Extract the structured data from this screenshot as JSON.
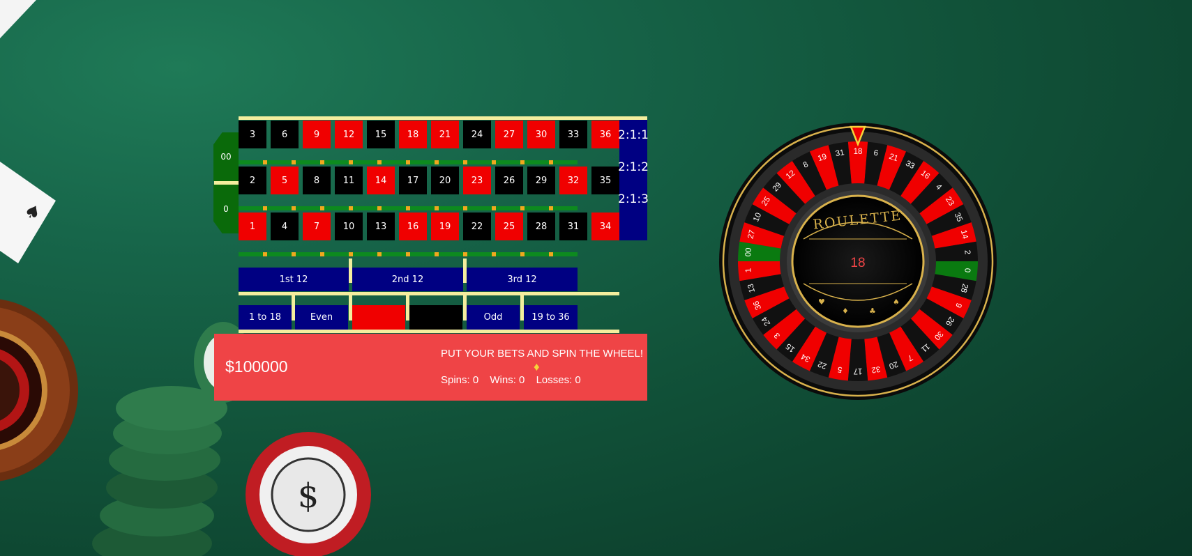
{
  "table": {
    "rows": [
      [
        [
          "3",
          "black"
        ],
        [
          "6",
          "black"
        ],
        [
          "9",
          "red"
        ],
        [
          "12",
          "red"
        ],
        [
          "15",
          "black"
        ],
        [
          "18",
          "red"
        ],
        [
          "21",
          "red"
        ],
        [
          "24",
          "black"
        ],
        [
          "27",
          "red"
        ],
        [
          "30",
          "red"
        ],
        [
          "33",
          "black"
        ],
        [
          "36",
          "red"
        ]
      ],
      [
        [
          "2",
          "black"
        ],
        [
          "5",
          "red"
        ],
        [
          "8",
          "black"
        ],
        [
          "11",
          "black"
        ],
        [
          "14",
          "red"
        ],
        [
          "17",
          "black"
        ],
        [
          "20",
          "black"
        ],
        [
          "23",
          "red"
        ],
        [
          "26",
          "black"
        ],
        [
          "29",
          "black"
        ],
        [
          "32",
          "red"
        ],
        [
          "35",
          "black"
        ]
      ],
      [
        [
          "1",
          "red"
        ],
        [
          "4",
          "black"
        ],
        [
          "7",
          "red"
        ],
        [
          "10",
          "black"
        ],
        [
          "13",
          "black"
        ],
        [
          "16",
          "red"
        ],
        [
          "19",
          "red"
        ],
        [
          "22",
          "black"
        ],
        [
          "25",
          "red"
        ],
        [
          "28",
          "black"
        ],
        [
          "31",
          "black"
        ],
        [
          "34",
          "red"
        ]
      ]
    ],
    "zero_top": "00",
    "zero_bottom": "0",
    "column_bets": [
      "2:1:1",
      "2:1:2",
      "2:1:3"
    ],
    "dozens": [
      "1st 12",
      "2nd 12",
      "3rd 12"
    ],
    "even_money": [
      {
        "label": "1 to 18",
        "fill": "#000082"
      },
      {
        "label": "Even",
        "fill": "#000082"
      },
      {
        "label": "",
        "fill": "#f00000"
      },
      {
        "label": "",
        "fill": "#000000"
      },
      {
        "label": "Odd",
        "fill": "#000082"
      },
      {
        "label": "19 to 36",
        "fill": "#000082"
      }
    ]
  },
  "status": {
    "balance": "$100000",
    "message": "PUT YOUR BETS AND SPIN THE WHEEL!",
    "diamond": "♦",
    "spins": "Spins: 0",
    "wins": "Wins: 0",
    "losses": "Losses: 0"
  },
  "wheel": {
    "brand": "ROULETTE",
    "result": "18",
    "sequence": [
      "18",
      "6",
      "21",
      "33",
      "16",
      "4",
      "23",
      "35",
      "14",
      "2",
      "0",
      "28",
      "9",
      "26",
      "30",
      "11",
      "7",
      "20",
      "32",
      "17",
      "5",
      "22",
      "34",
      "15",
      "3",
      "24",
      "36",
      "13",
      "1",
      "00",
      "27",
      "10",
      "25",
      "29",
      "12",
      "8",
      "19",
      "31"
    ],
    "reds": [
      "1",
      "3",
      "5",
      "7",
      "9",
      "12",
      "14",
      "16",
      "18",
      "19",
      "21",
      "23",
      "25",
      "27",
      "30",
      "32",
      "34",
      "36"
    ],
    "greens": [
      "0",
      "00"
    ],
    "colors": {
      "red": "#f00000",
      "black": "#111111",
      "green": "#0a7a10",
      "gold": "#d9b24c"
    }
  },
  "colors": {
    "felt": "#115239",
    "panel": "#ef4446",
    "outside_bet": "#000082",
    "rail": "#f4ee9e",
    "rail_green": "#0d8a1f",
    "dot": "#f0a81e"
  }
}
